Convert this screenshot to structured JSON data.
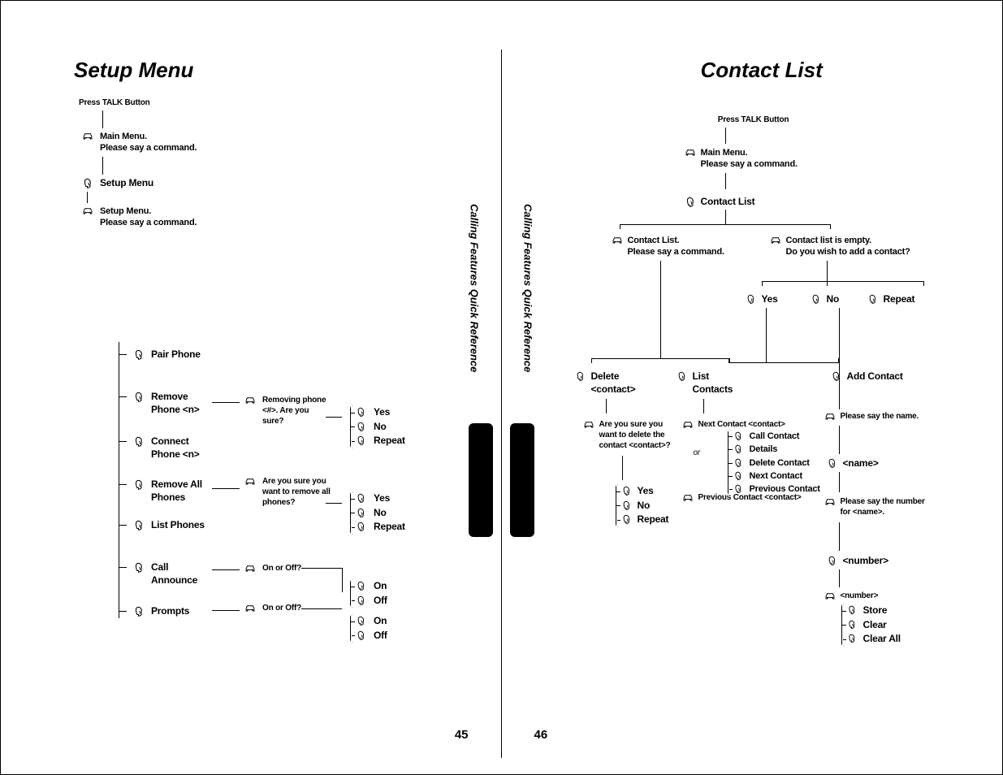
{
  "left": {
    "title": "Setup Menu",
    "press_talk": "Press TALK Button",
    "main_menu": "Main Menu.",
    "say_command": "Please say a command.",
    "setup_menu": "Setup Menu",
    "setup_menu_prompt": "Setup Menu.",
    "items": {
      "pair_phone": "Pair Phone",
      "remove_phone": "Remove Phone <n>",
      "connect_phone": "Connect Phone <n>",
      "remove_all": "Remove All Phones",
      "list_phones": "List Phones",
      "call_announce": "Call Announce",
      "prompts": "Prompts"
    },
    "removing_phone": "Removing phone <#>. Are you sure?",
    "remove_all_q": "Are you sure you want to remove all phones?",
    "on_or_off": "On or Off?",
    "yes": "Yes",
    "no": "No",
    "repeat": "Repeat",
    "on": "On",
    "off": "Off",
    "sidetab": "Calling Features Quick Reference",
    "pagenum": "45"
  },
  "right": {
    "title": "Contact List",
    "press_talk": "Press TALK Button",
    "main_menu": "Main Menu.",
    "say_command": "Please say a command.",
    "contact_list": "Contact List",
    "cl_prompt": "Contact List.",
    "cl_empty": "Contact list is empty.",
    "cl_empty2": "Do you wish to add a contact?",
    "yes": "Yes",
    "no": "No",
    "repeat": "Repeat",
    "delete_contact": "Delete <contact>",
    "list_contacts": "List Contacts",
    "add_contact": "Add Contact",
    "delete_q": "Are you sure you want to delete the contact <contact>?",
    "next_contact": "Next Contact <contact>",
    "prev_contact": "Previous Contact <contact>",
    "or": "or",
    "options": {
      "call": "Call Contact",
      "details": "Details",
      "delete": "Delete Contact",
      "next": "Next Contact",
      "prev": "Previous Contact"
    },
    "say_name": "Please say the name.",
    "name": "<name>",
    "say_number": "Please say the number for <name>.",
    "number": "<number>",
    "number_echo": "<number>",
    "store": "Store",
    "clear": "Clear",
    "clear_all": "Clear All",
    "sidetab": "Calling Features Quick Reference",
    "pagenum": "46"
  }
}
